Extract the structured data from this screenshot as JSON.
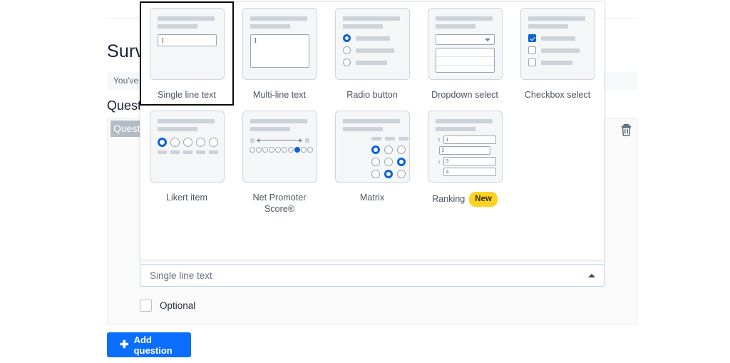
{
  "page": {
    "survey_title": "Surve",
    "notice_text": "You've c",
    "questions_heading": "Questio",
    "question_label": "Questio",
    "delete_icon": "trash-icon"
  },
  "type_select": {
    "value": "Single line text",
    "caret_icon": "chevron-up-icon",
    "state": "open"
  },
  "optional": {
    "label": "Optional",
    "checked": false
  },
  "add_question_button": {
    "label": "Add question",
    "icon": "plus-icon",
    "color": "#0b6efd"
  },
  "dropdown_panel": {
    "options": [
      {
        "label": "Single line text",
        "icon": "single-line-text-icon",
        "focused": true
      },
      {
        "label": "Multi-line text",
        "icon": "multi-line-text-icon",
        "focused": false
      },
      {
        "label": "Radio button",
        "icon": "radio-button-icon",
        "focused": false
      },
      {
        "label": "Dropdown select",
        "icon": "dropdown-select-icon",
        "focused": false
      },
      {
        "label": "Checkbox select",
        "icon": "checkbox-select-icon",
        "focused": false
      },
      {
        "label": "Likert item",
        "icon": "likert-item-icon",
        "focused": false
      },
      {
        "label": "Net Promoter Score®",
        "icon": "net-promoter-score-icon",
        "focused": false
      },
      {
        "label": "Matrix",
        "icon": "matrix-icon",
        "focused": false
      },
      {
        "label": "Ranking",
        "icon": "ranking-icon",
        "focused": false,
        "badge": "New"
      }
    ],
    "badge_color": "#ffd325"
  },
  "ranking_preview": {
    "items": [
      "1",
      "2",
      "3",
      "4"
    ]
  },
  "colors": {
    "accent_blue": "#0b61d6",
    "button_blue": "#0b6efd",
    "badge_yellow": "#ffd325",
    "skeleton_gray": "#ccd2d9",
    "panel_bg": "#f4f6f8"
  }
}
